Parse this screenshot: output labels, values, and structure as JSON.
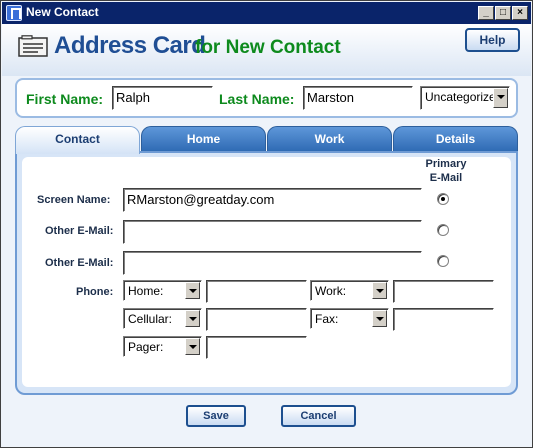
{
  "window": {
    "title": "New Contact"
  },
  "header": {
    "title": "Address Card",
    "subtitle": "for New Contact",
    "help_label": "Help"
  },
  "name": {
    "first_label": "First Name:",
    "first_value": "Ralph",
    "last_label": "Last Name:",
    "last_value": "Marston",
    "category": "Uncategorized"
  },
  "tabs": [
    {
      "label": "Contact",
      "active": true
    },
    {
      "label": "Home"
    },
    {
      "label": "Work"
    },
    {
      "label": "Details"
    }
  ],
  "contact": {
    "primary_line1": "Primary",
    "primary_line2": "E-Mail",
    "screen_name_label": "Screen Name:",
    "screen_name_value": "RMarston@greatday.com",
    "other_email_label_1": "Other E-Mail:",
    "other_email_label_2": "Other E-Mail:",
    "phone_label": "Phone:",
    "phone_types": [
      "Home:",
      "Work:",
      "Cellular:",
      "Fax:",
      "Pager:"
    ]
  },
  "buttons": {
    "save": "Save",
    "cancel": "Cancel"
  },
  "colors": {
    "title_blue": "#1f4e94",
    "accent_green": "#0d8a1d",
    "tab_blue": "#2d69b3"
  }
}
